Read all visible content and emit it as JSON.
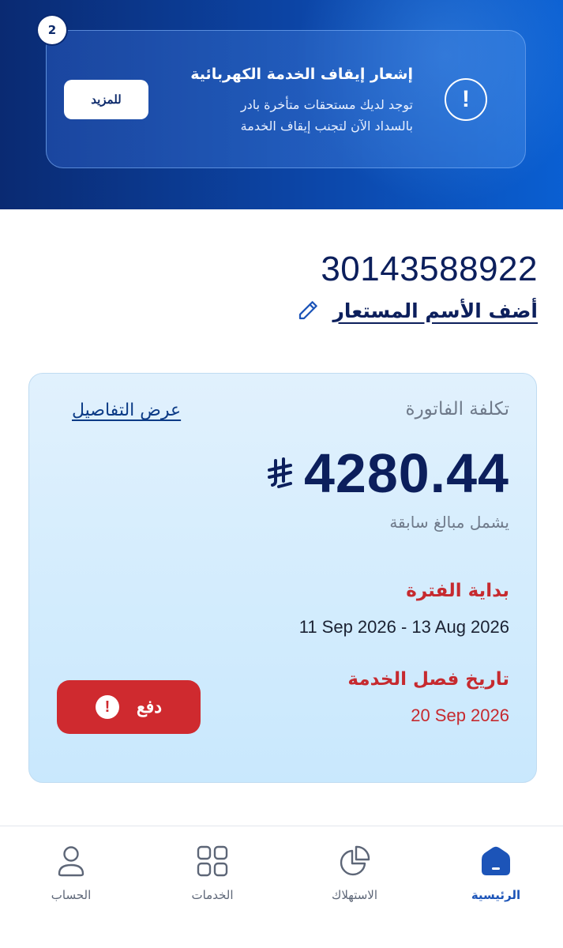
{
  "notice": {
    "count": "2",
    "title": "إشعار إيقاف الخدمة الكهربائية",
    "body": "توجد لديك مستحقات متأخرة بادر بالسداد الآن لتجنب إيقاف الخدمة",
    "more_label": "للمزيد",
    "icon": "alert-circle-icon"
  },
  "account": {
    "number": "30143588922",
    "alias_link": "أضف الأسم المستعار",
    "alias_icon": "pencil-icon"
  },
  "bill": {
    "label": "تكلفة الفاتورة",
    "details_link": "عرض التفاصيل",
    "amount": "4280.44",
    "currency_icon": "saudi-riyal-icon",
    "includes_note": "يشمل مبالغ سابقة",
    "period_label": "بداية الفترة",
    "period_value": "11 Sep 2026 - 13 Aug 2026",
    "cutoff_label": "تاريخ فصل الخدمة",
    "cutoff_value": "20 Sep 2026",
    "pay_label": "دفع",
    "pay_icon": "alert-circle-icon"
  },
  "nav": {
    "items": [
      {
        "label": "الرئيسية",
        "icon": "home-icon",
        "active": true
      },
      {
        "label": "الاستهلاك",
        "icon": "pie-chart-icon",
        "active": false
      },
      {
        "label": "الخدمات",
        "icon": "grid-icon",
        "active": false
      },
      {
        "label": "الحساب",
        "icon": "user-icon",
        "active": false
      }
    ]
  },
  "colors": {
    "primary_dark": "#0c1f5c",
    "accent_blue": "#1c54b8",
    "danger_red": "#cf2a2f",
    "banner_blue": "#0c46a8"
  }
}
